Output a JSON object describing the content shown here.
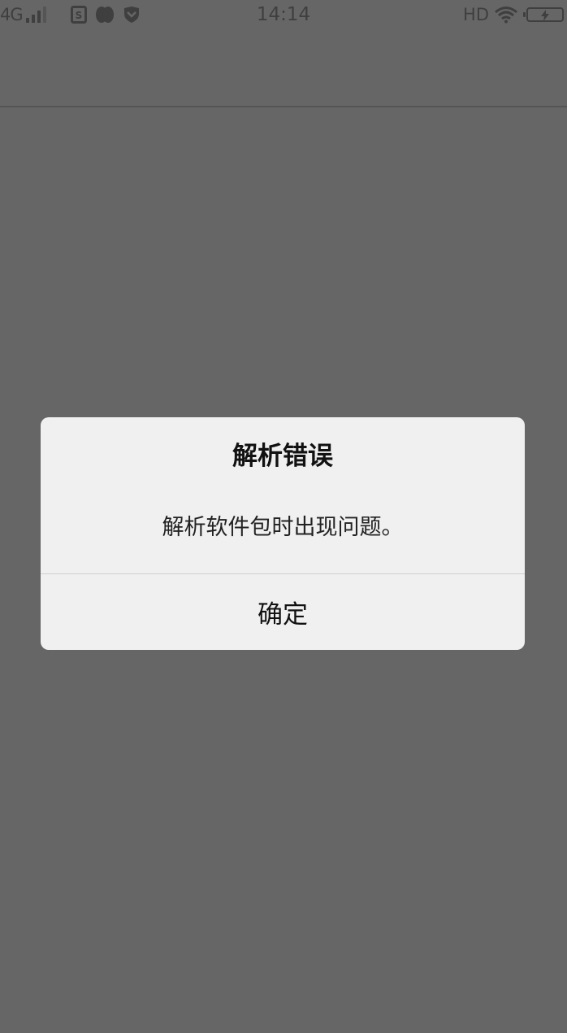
{
  "status_bar": {
    "network": "4G",
    "time": "14:14",
    "hd": "HD",
    "icons": [
      "signal-icon",
      "sim-s-icon",
      "leaf-app-icon",
      "shield-app-icon",
      "wifi-icon",
      "battery-charging-icon"
    ]
  },
  "dialog": {
    "title": "解析错误",
    "message": "解析软件包时出现问题。",
    "ok_label": "确定"
  },
  "colors": {
    "overlay": "#666666",
    "dialog_bg": "#f0f0f0",
    "divider": "#cfcfcf"
  }
}
